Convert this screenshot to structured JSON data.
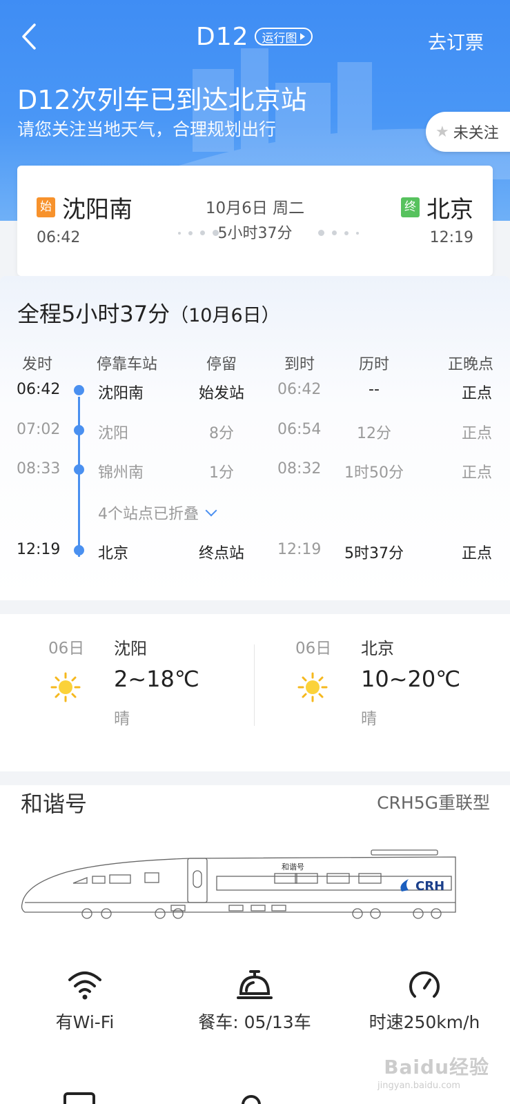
{
  "header": {
    "train_no": "D12",
    "run_chart_label": "运行图",
    "book_label": "去订票"
  },
  "status": {
    "title": "D12次列车已到达北京站",
    "subtitle": "请您关注当地天气，合理规划出行",
    "follow_label": "未关注"
  },
  "route": {
    "start_tag": "始",
    "end_tag": "终",
    "from_station": "沈阳南",
    "from_time": "06:42",
    "to_station": "北京",
    "to_time": "12:19",
    "date": "10月6日 周二",
    "duration": "5小时37分"
  },
  "schedule": {
    "title": "全程5小时37分",
    "title_date": "（10月6日）",
    "headers": [
      "发时",
      "停靠车站",
      "停留",
      "到时",
      "历时",
      "正晚点"
    ],
    "rows": [
      {
        "depart": "06:42",
        "station": "沈阳南",
        "stay": "始发站",
        "arrive": "06:42",
        "elapsed": "--",
        "status": "正点"
      },
      {
        "depart": "07:02",
        "station": "沈阳",
        "stay": "8分",
        "arrive": "06:54",
        "elapsed": "12分",
        "status": "正点"
      },
      {
        "depart": "08:33",
        "station": "锦州南",
        "stay": "1分",
        "arrive": "08:32",
        "elapsed": "1时50分",
        "status": "正点"
      },
      {
        "depart": "12:19",
        "station": "北京",
        "stay": "终点站",
        "arrive": "12:19",
        "elapsed": "5时37分",
        "status": "正点"
      }
    ],
    "folded_label": "4个站点已折叠"
  },
  "weather": [
    {
      "day": "06日",
      "city": "沈阳",
      "temp": "2~18℃",
      "desc": "晴",
      "icon": "sun-icon"
    },
    {
      "day": "06日",
      "city": "北京",
      "temp": "10~20℃",
      "desc": "晴",
      "icon": "sun-icon"
    }
  ],
  "train": {
    "name": "和谐号",
    "model": "CRH5G重联型",
    "body_logo": "和谐号",
    "brand_mark": "CRH",
    "features": [
      {
        "icon": "wifi-icon",
        "label": "有Wi-Fi"
      },
      {
        "icon": "dining-bell-icon",
        "label": "餐车: 05/13车"
      },
      {
        "icon": "speedometer-icon",
        "label": "时速250km/h"
      }
    ]
  },
  "watermark": {
    "text": "Baidu经验",
    "url": "jingyan.baidu.com"
  },
  "colors": {
    "primary_blue": "#4a90f0",
    "start_tag": "#f7922c",
    "end_tag": "#57c25e"
  }
}
